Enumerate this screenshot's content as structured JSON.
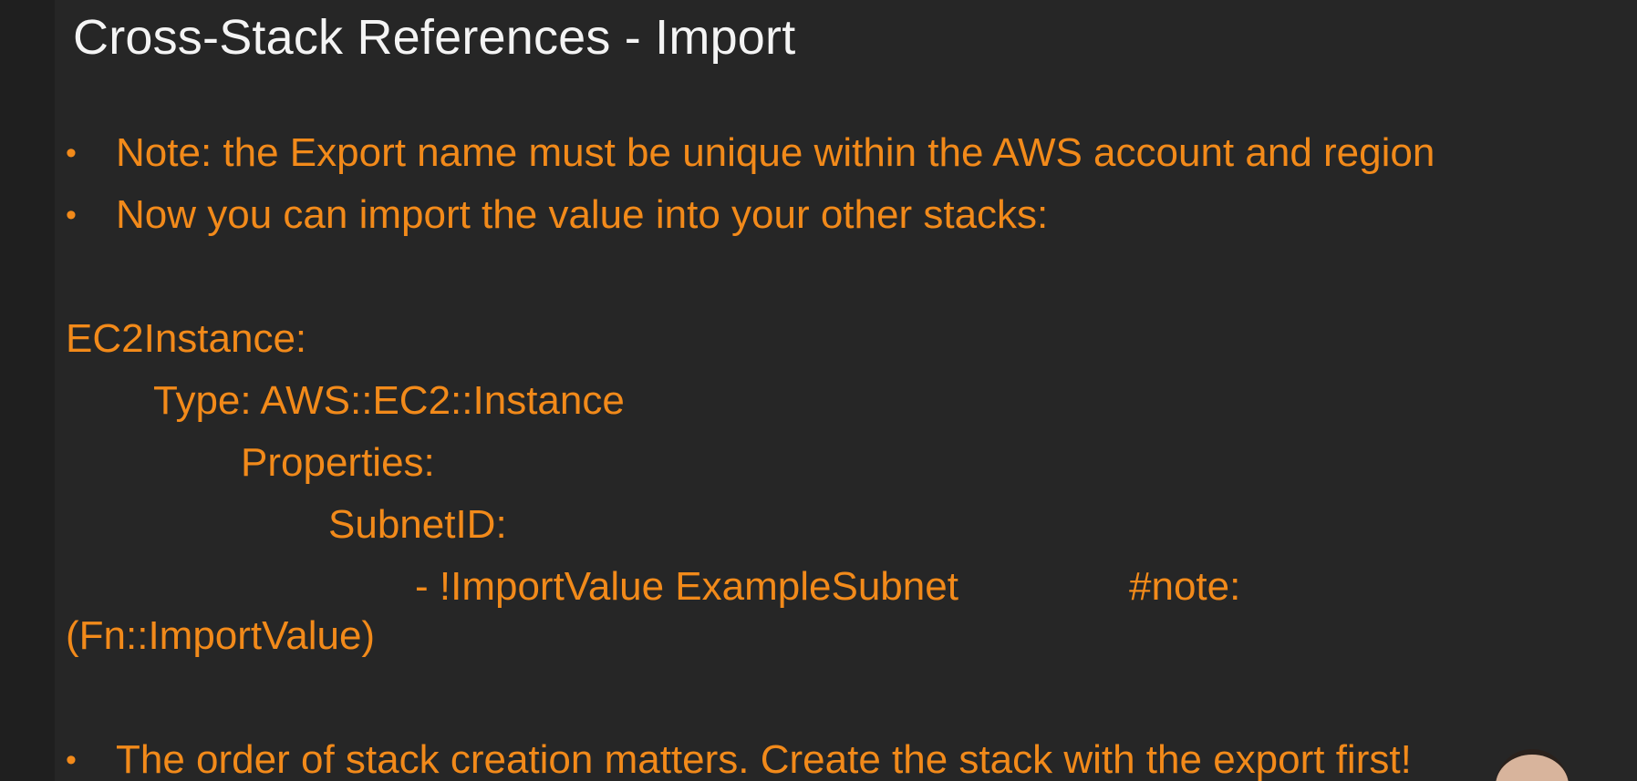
{
  "slide": {
    "title": "Cross-Stack References - Import",
    "bullets": [
      "Note: the Export name must be unique within the AWS account and region",
      "Now you can import the value into your other stacks:"
    ],
    "code_lines": [
      "EC2Instance:",
      "Type: AWS::EC2::Instance",
      "Properties:",
      "SubnetID:",
      "- !ImportValue ExampleSubnet",
      "#note:",
      "(Fn::ImportValue)"
    ],
    "footer_bullet": "The order of stack creation matters. Create the stack with the export first!",
    "bullet_symbol": "•"
  },
  "colors": {
    "background": "#262626",
    "title": "#f4f4f4",
    "accent": "#f28a1a"
  }
}
